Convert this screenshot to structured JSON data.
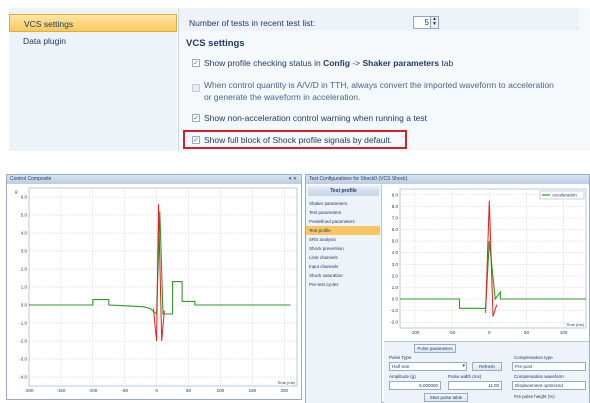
{
  "settings": {
    "nav": [
      "VCS settings",
      "Data plugin"
    ],
    "recent_label": "Number of tests in recent test list:",
    "recent_value": "5",
    "section": "VCS settings",
    "opt1_pre": "Show profile checking status in ",
    "opt1_b1": "Config",
    "opt1_mid": " -> ",
    "opt1_b2": "Shaker parameters",
    "opt1_post": " tab",
    "opt2_l1": "When control quantity is A/V/D in TTH, always convert the imported waveform to acceleration",
    "opt2_l2": "or generate the waveform in acceleration.",
    "opt3": "Show non-acceleration control warning when running a test",
    "opt4": "Show full block of Shock profile signals by default.",
    "opt_checked": [
      true,
      false,
      true,
      true
    ]
  },
  "control": {
    "title": "Control Composite",
    "yunit": "g",
    "yticks": [
      "6.0",
      "5.0",
      "4.0",
      "3.0",
      "2.0",
      "1.0",
      "0.0",
      "-1.0",
      "-2.0",
      "-3.0",
      "-4.0"
    ],
    "xticks": [
      "-200",
      "-150",
      "-100",
      "-50",
      "0",
      "50",
      "100",
      "150",
      "200"
    ],
    "xlabel": "Time (ms)"
  },
  "dialog": {
    "title": "Test Configurations for Shock0 (VCS Shock)",
    "tab": "Test profile",
    "items": [
      "Shaker parameters",
      "Test parameters",
      "Predefined parameters",
      "Test profile",
      "SRS analysis",
      "Shock prevention",
      "Limit channels",
      "Input channels",
      "Shock saturation",
      "Pre-test cycles"
    ],
    "selected_index": 3,
    "legend": "Acceleration",
    "yticks": [
      "9.0",
      "8.0",
      "7.0",
      "6.0",
      "5.0",
      "4.0",
      "3.0",
      "2.0",
      "1.0",
      "0.0",
      "-1.0",
      "-2.0"
    ],
    "xticks": [
      "-100",
      "-50",
      "0",
      "50",
      "100"
    ],
    "xlabel": "Time (ms)",
    "pulse_tab": "Pulse parameters",
    "pulse_type_label": "Pulse Type",
    "pulse_type": "Half sine",
    "refresh": "Refresh",
    "amp_label": "Amplitude (g)",
    "amp_value": "5.000000",
    "width_label": "Pulse width (ms)",
    "width_value": "11.00",
    "comp_type_label": "Compensation type",
    "comp_type": "Pre-post",
    "comp_waveform_label": "Compensation waveform",
    "comp_waveform": "Displacement optimized",
    "prepost_label": "Pre pulse height (%)",
    "pulse_table": "Start pulse table"
  },
  "colors": {
    "green": "#2e9a2a",
    "red": "#e0201a",
    "highlight": "#d0202a",
    "select": "#f8c660"
  },
  "chart_data": [
    {
      "type": "line",
      "title": "Control Composite",
      "xlabel": "Time (ms)",
      "ylabel": "g",
      "xlim": [
        -200,
        220
      ],
      "ylim": [
        -4.5,
        6.5
      ],
      "x_ticks": [
        -200,
        -150,
        -100,
        -50,
        0,
        50,
        100,
        150,
        200
      ],
      "y_ticks": [
        6,
        5,
        4,
        3,
        2,
        1,
        0,
        -1,
        -2,
        -3,
        -4
      ],
      "grid": true,
      "series": [
        {
          "values": [
            [
              -200,
              0
            ],
            [
              -100,
              0
            ],
            [
              -100,
              0.3
            ],
            [
              -75,
              0.3
            ],
            [
              -75,
              0
            ],
            [
              -20,
              -0.1
            ],
            [
              -10,
              -0.2
            ],
            [
              0,
              -0.5
            ],
            [
              5,
              5.2
            ],
            [
              10,
              -0.5
            ],
            [
              25,
              -0.5
            ],
            [
              25,
              1.3
            ],
            [
              40,
              1.3
            ],
            [
              40,
              0.2
            ],
            [
              60,
              0.2
            ],
            [
              60,
              0
            ],
            [
              210,
              0
            ]
          ]
        },
        {
          "values": [
            [
              -5,
              -0.2
            ],
            [
              0,
              -2.0
            ],
            [
              3,
              5.6
            ],
            [
              8,
              -2.0
            ],
            [
              12,
              -0.3
            ]
          ]
        }
      ]
    },
    {
      "type": "line",
      "title": "",
      "xlabel": "Time (ms)",
      "ylabel": "",
      "xlim": [
        -120,
        130
      ],
      "ylim": [
        -2.5,
        9.5
      ],
      "x_ticks": [
        -100,
        -50,
        0,
        50,
        100
      ],
      "y_ticks": [
        9,
        8,
        7,
        6,
        5,
        4,
        3,
        2,
        1,
        0,
        -1,
        -2
      ],
      "grid": true,
      "legend": "top-right",
      "series": [
        {
          "name": "Acceleration",
          "values": [
            [
              -120,
              0
            ],
            [
              -40,
              0
            ],
            [
              -40,
              -0.8
            ],
            [
              -5,
              -0.8
            ],
            [
              0,
              5
            ],
            [
              8,
              0
            ],
            [
              15,
              0.6
            ],
            [
              15,
              0
            ],
            [
              130,
              0
            ]
          ]
        },
        {
          "values": [
            [
              -5,
              -1.2
            ],
            [
              0,
              8.5
            ],
            [
              5,
              -1.5
            ],
            [
              10,
              -0.5
            ]
          ]
        }
      ]
    }
  ]
}
